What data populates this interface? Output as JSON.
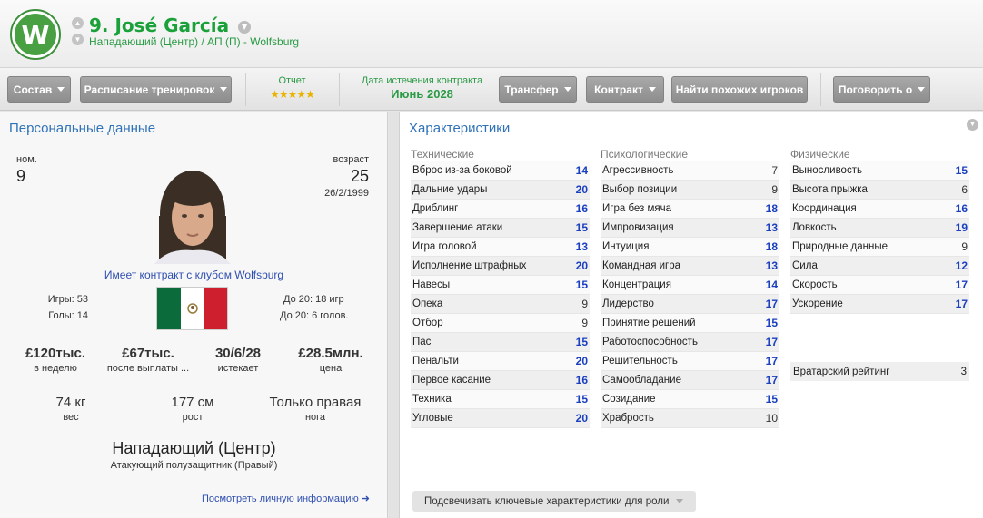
{
  "header": {
    "player_name": "9. José García",
    "player_subtitle": "Нападающий (Центр) / АП (П) - Wolfsburg",
    "club_crest_letter": "W"
  },
  "toolbar": {
    "squad": "Состав",
    "training": "Расписание тренировок",
    "report_label": "Отчет",
    "report_stars": "★★★★★",
    "contract_expiry_label": "Дата истечения контракта",
    "contract_expiry_value": "Июнь 2028",
    "transfer": "Трансфер",
    "contract": "Контракт",
    "find_similar": "Найти похожих игроков",
    "talk_to": "Поговорить о"
  },
  "personal": {
    "title": "Персональные данные",
    "number_label": "ном.",
    "number": "9",
    "age_label": "возраст",
    "age": "25",
    "dob": "26/2/1999",
    "contract_club": "Имеет контракт с клубом Wolfsburg",
    "games": "Игры: 53",
    "goals": "Голы: 14",
    "u20_games": "До 20: 18 игр",
    "u20_goals": "До 20: 6 голов.",
    "wage_value": "£120тыс.",
    "wage_label": "в неделю",
    "release_value": "£67тыс.",
    "release_label": "после выплаты ...",
    "expires_value": "30/6/28",
    "expires_label": "истекает",
    "value_value": "£28.5млн.",
    "value_label": "цена",
    "weight_value": "74 кг",
    "weight_label": "вес",
    "height_value": "177 см",
    "height_label": "рост",
    "foot_value": "Только правая",
    "foot_label": "нога",
    "position_main": "Нападающий (Центр)",
    "position_sub": "Атакующий полузащитник (Правый)",
    "view_personal": "Посмотреть личную информацию ➜"
  },
  "attributes": {
    "title": "Характеристики",
    "technical_head": "Технические",
    "mental_head": "Психологические",
    "physical_head": "Физические",
    "technical": [
      {
        "name": "Вброс из-за боковой",
        "value": "14"
      },
      {
        "name": "Дальние удары",
        "value": "20"
      },
      {
        "name": "Дриблинг",
        "value": "16"
      },
      {
        "name": "Завершение атаки",
        "value": "15"
      },
      {
        "name": "Игра головой",
        "value": "13"
      },
      {
        "name": "Исполнение штрафных",
        "value": "20"
      },
      {
        "name": "Навесы",
        "value": "15"
      },
      {
        "name": "Опека",
        "value": "9"
      },
      {
        "name": "Отбор",
        "value": "9"
      },
      {
        "name": "Пас",
        "value": "15"
      },
      {
        "name": "Пенальти",
        "value": "20"
      },
      {
        "name": "Первое касание",
        "value": "16"
      },
      {
        "name": "Техника",
        "value": "15"
      },
      {
        "name": "Угловые",
        "value": "20"
      }
    ],
    "mental": [
      {
        "name": "Агрессивность",
        "value": "7"
      },
      {
        "name": "Выбор позиции",
        "value": "9"
      },
      {
        "name": "Игра без мяча",
        "value": "18"
      },
      {
        "name": "Импровизация",
        "value": "13"
      },
      {
        "name": "Интуиция",
        "value": "18"
      },
      {
        "name": "Командная игра",
        "value": "13"
      },
      {
        "name": "Концентрация",
        "value": "14"
      },
      {
        "name": "Лидерство",
        "value": "17"
      },
      {
        "name": "Принятие решений",
        "value": "15"
      },
      {
        "name": "Работоспособность",
        "value": "17"
      },
      {
        "name": "Решительность",
        "value": "17"
      },
      {
        "name": "Самообладание",
        "value": "17"
      },
      {
        "name": "Созидание",
        "value": "15"
      },
      {
        "name": "Храбрость",
        "value": "10"
      }
    ],
    "physical": [
      {
        "name": "Выносливость",
        "value": "15"
      },
      {
        "name": "Высота прыжка",
        "value": "6"
      },
      {
        "name": "Координация",
        "value": "16"
      },
      {
        "name": "Ловкость",
        "value": "19"
      },
      {
        "name": "Природные данные",
        "value": "9"
      },
      {
        "name": "Сила",
        "value": "12"
      },
      {
        "name": "Скорость",
        "value": "17"
      },
      {
        "name": "Ускорение",
        "value": "17"
      }
    ],
    "gk_rating_label": "Вратарский рейтинг",
    "gk_rating_value": "3",
    "highlight_button": "Подсвечивать ключевые характеристики для роли"
  },
  "colors": {
    "accent_green": "#2a9a44",
    "link_blue": "#2f72b8",
    "high_value_blue": "#1a3fc0"
  }
}
